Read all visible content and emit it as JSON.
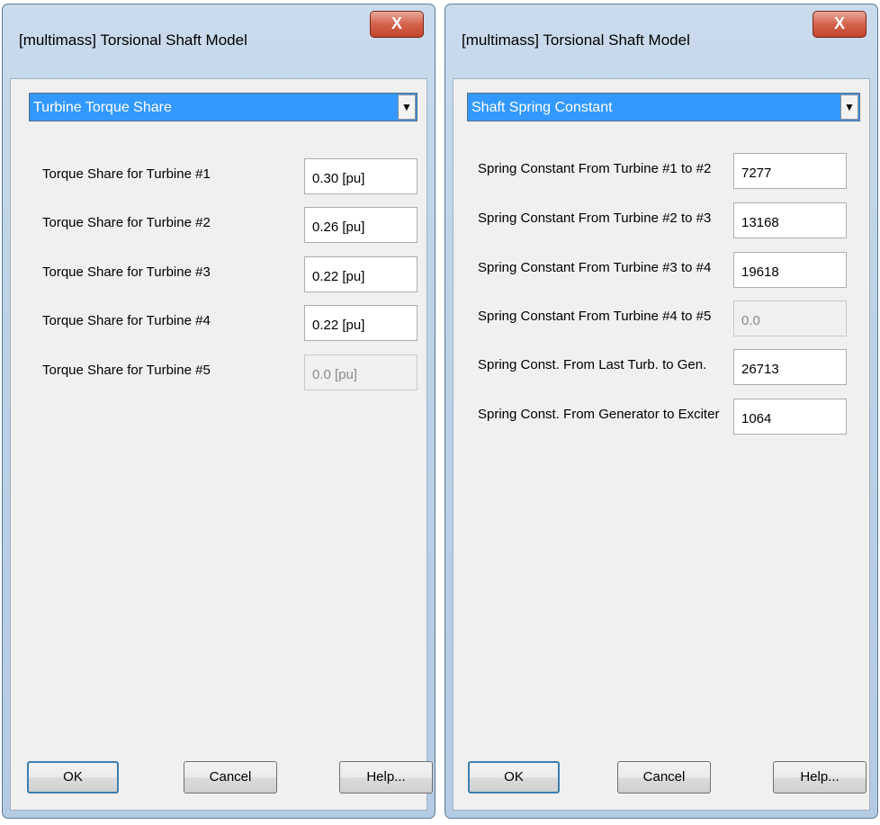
{
  "left_dialog": {
    "title": "[multimass] Torsional Shaft Model",
    "close_label": "X",
    "dropdown": {
      "selected": "Turbine Torque Share",
      "arrow": "▼"
    },
    "rows": [
      {
        "label": "Torque Share for Turbine #1",
        "value": "0.30 [pu]"
      },
      {
        "label": "Torque Share for Turbine #2",
        "value": "0.26 [pu]"
      },
      {
        "label": "Torque Share for Turbine #3",
        "value": "0.22 [pu]"
      },
      {
        "label": "Torque Share for Turbine #4",
        "value": "0.22 [pu]"
      },
      {
        "label": "Torque Share for Turbine #5",
        "value": "0.0 [pu]",
        "disabled": true
      }
    ],
    "buttons": {
      "ok": "OK",
      "cancel": "Cancel",
      "help": "Help..."
    }
  },
  "right_dialog": {
    "title": "[multimass] Torsional Shaft Model",
    "close_label": "X",
    "dropdown": {
      "selected": "Shaft Spring Constant",
      "arrow": "▼"
    },
    "rows": [
      {
        "label": "Spring Constant From Turbine #1 to #2",
        "value": "7277"
      },
      {
        "label": "Spring Constant From Turbine #2 to #3",
        "value": "13168"
      },
      {
        "label": "Spring Constant From Turbine #3 to #4",
        "value": "19618"
      },
      {
        "label": "Spring Constant From Turbine #4 to #5",
        "value": "0.0",
        "disabled": true
      },
      {
        "label": "Spring Const. From Last Turb. to Gen.",
        "value": "26713"
      },
      {
        "label": "Spring Const. From Generator to Exciter",
        "value": "1064"
      }
    ],
    "buttons": {
      "ok": "OK",
      "cancel": "Cancel",
      "help": "Help..."
    }
  },
  "colors": {
    "dropdown_highlight": "#3399ff",
    "window_frame": "#bcd1e6",
    "close_button": "#c2452c",
    "client_area": "#f0f0f0"
  }
}
